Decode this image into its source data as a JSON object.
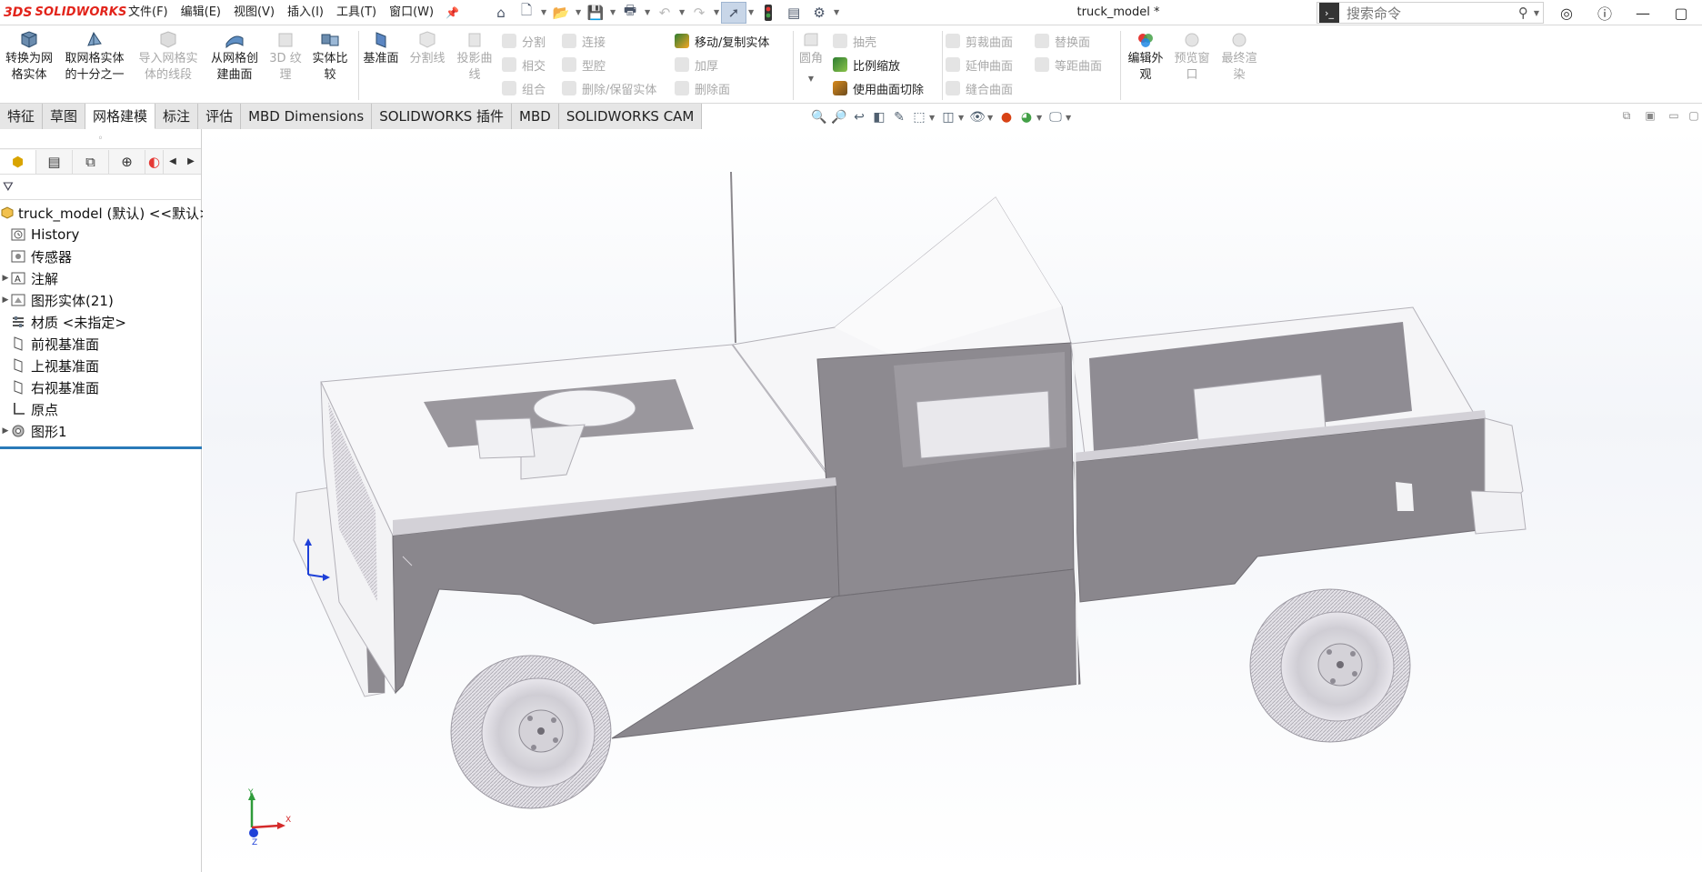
{
  "app": {
    "brand": "SOLIDWORKS",
    "brand_prefix": "3DS",
    "document_title": "truck_model *"
  },
  "menu": [
    "文件(F)",
    "编辑(E)",
    "视图(V)",
    "插入(I)",
    "工具(T)",
    "窗口(W)"
  ],
  "quick_access": [
    "home-icon",
    "new-document-icon",
    "open-icon",
    "save-icon",
    "print-icon",
    "undo-icon",
    "redo-icon",
    "select-icon",
    "traffic-light-icon",
    "file-properties-icon",
    "options-icon"
  ],
  "search": {
    "placeholder": "搜索命令"
  },
  "command_manager": {
    "big_buttons": [
      {
        "label": "转换为网\n格实体",
        "enabled": true
      },
      {
        "label": "取网格实体\n的十分之一",
        "enabled": true
      },
      {
        "label": "导入网格实\n体的线段",
        "enabled": false
      },
      {
        "label": "从网格创\n建曲面",
        "enabled": true
      },
      {
        "label": "3D 纹\n理",
        "enabled": false
      },
      {
        "label": "实体比\n较",
        "enabled": true
      },
      {
        "label": "基准面",
        "enabled": true
      },
      {
        "label": "分割线",
        "enabled": false
      },
      {
        "label": "投影曲\n线",
        "enabled": false
      },
      {
        "label": "圆角",
        "enabled": false
      },
      {
        "label": "编辑外\n观",
        "enabled": true
      },
      {
        "label": "预览窗\n口",
        "enabled": false
      },
      {
        "label": "最终渲\n染",
        "enabled": false
      }
    ],
    "small_buttons": [
      {
        "label": "分割",
        "enabled": false
      },
      {
        "label": "相交",
        "enabled": false
      },
      {
        "label": "组合",
        "enabled": false
      },
      {
        "label": "连接",
        "enabled": false
      },
      {
        "label": "型腔",
        "enabled": false
      },
      {
        "label": "删除/保留实体",
        "enabled": false
      },
      {
        "label": "移动/复制实体",
        "enabled": true
      },
      {
        "label": "加厚",
        "enabled": false
      },
      {
        "label": "删除面",
        "enabled": false
      },
      {
        "label": "抽壳",
        "enabled": false
      },
      {
        "label": "比例缩放",
        "enabled": true
      },
      {
        "label": "使用曲面切除",
        "enabled": true
      },
      {
        "label": "剪裁曲面",
        "enabled": false
      },
      {
        "label": "延伸曲面",
        "enabled": false
      },
      {
        "label": "缝合曲面",
        "enabled": false
      },
      {
        "label": "替换面",
        "enabled": false
      },
      {
        "label": "等距曲面",
        "enabled": false
      }
    ]
  },
  "tabs": [
    {
      "label": "特征",
      "active": false
    },
    {
      "label": "草图",
      "active": false
    },
    {
      "label": "网格建模",
      "active": true
    },
    {
      "label": "标注",
      "active": false
    },
    {
      "label": "评估",
      "active": false
    },
    {
      "label": "MBD Dimensions",
      "active": false
    },
    {
      "label": "SOLIDWORKS 插件",
      "active": false
    },
    {
      "label": "MBD",
      "active": false
    },
    {
      "label": "SOLIDWORKS CAM",
      "active": false
    }
  ],
  "feature_tree": {
    "root": "truck_model (默认) <<默认>",
    "items": [
      {
        "label": "History",
        "expandable": false
      },
      {
        "label": "传感器",
        "expandable": false
      },
      {
        "label": "注解",
        "expandable": true
      },
      {
        "label": "图形实体(21)",
        "expandable": true
      },
      {
        "label": "材质 <未指定>",
        "expandable": false
      },
      {
        "label": "前视基准面",
        "expandable": false
      },
      {
        "label": "上视基准面",
        "expandable": false
      },
      {
        "label": "右视基准面",
        "expandable": false
      },
      {
        "label": "原点",
        "expandable": false
      },
      {
        "label": "图形1",
        "expandable": true
      }
    ]
  },
  "viewport": {
    "triad_labels": {
      "x": "X",
      "y": "Y",
      "z": "Z"
    }
  },
  "colors": {
    "brand_red": "#e2231a",
    "model_gray": "#8a878c",
    "model_light": "#f4f4f6",
    "active_tab": "#ffffff",
    "tab_bg": "#e6e6e6",
    "selection_blue": "#2a7ab8"
  }
}
